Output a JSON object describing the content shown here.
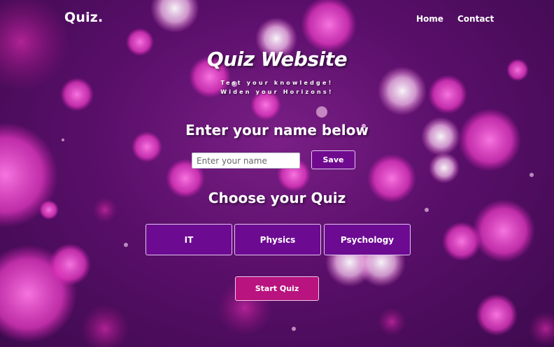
{
  "navbar": {
    "brand": "Quiz.",
    "links": [
      "Home",
      "Contact"
    ]
  },
  "hero": {
    "title": "Quiz Website",
    "subtitle_line1": "Test your knowledge!",
    "subtitle_line2": "Widen your Horizons!"
  },
  "name_section": {
    "heading": "Enter your name below",
    "input_placeholder": "Enter your name",
    "input_value": "",
    "save_label": "Save"
  },
  "quiz_section": {
    "heading": "Choose your Quiz",
    "options": [
      "IT",
      "Physics",
      "Psychology"
    ],
    "start_label": "Start Quiz"
  },
  "colors": {
    "background": "#5a0f6a",
    "option_button": "#6c0a92",
    "start_button": "#b8137f",
    "bokeh": "#ff3fcf"
  }
}
